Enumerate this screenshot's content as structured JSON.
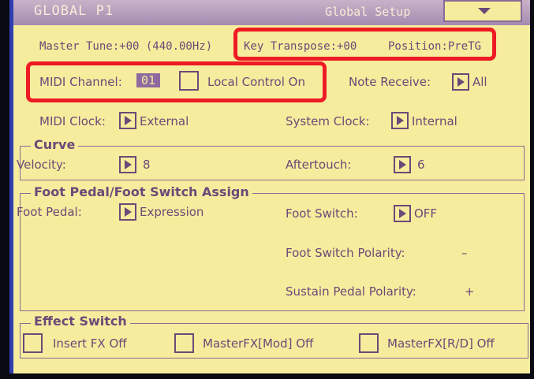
{
  "header": {
    "title": "GLOBAL P1",
    "page": "Global Setup"
  },
  "row1": {
    "master_tune": "Master Tune:+00 (440.00Hz)",
    "key_transpose": "Key Transpose:+00",
    "position": "Position:PreTG"
  },
  "row2": {
    "midi_channel_label": "MIDI Channel:",
    "midi_channel_value": "01",
    "local_control": "Local Control On",
    "note_receive_label": "Note Receive:",
    "note_receive_value": "All"
  },
  "row3": {
    "midi_clock_label": "MIDI Clock:",
    "midi_clock_value": "External",
    "system_clock_label": "System Clock:",
    "system_clock_value": "Internal"
  },
  "curve": {
    "title": "Curve",
    "velocity_label": "Velocity:",
    "velocity_value": "8",
    "aftertouch_label": "Aftertouch:",
    "aftertouch_value": "6"
  },
  "foot": {
    "title": "Foot Pedal/Foot Switch Assign",
    "pedal_label": "Foot Pedal:",
    "pedal_value": "Expression",
    "switch_label": "Foot Switch:",
    "switch_value": "OFF",
    "switch_polarity_label": "Foot Switch Polarity:",
    "switch_polarity_value": "–",
    "sustain_polarity_label": "Sustain Pedal Polarity:",
    "sustain_polarity_value": "+"
  },
  "effect": {
    "title": "Effect Switch",
    "insert": "Insert FX Off",
    "master_mod": "MasterFX[Mod] Off",
    "master_rd": "MasterFX[R/D] Off"
  },
  "colors": {
    "screen_bg": "#f6ec9d",
    "text": "#6a4a78",
    "highlight": "#ee1b24"
  }
}
